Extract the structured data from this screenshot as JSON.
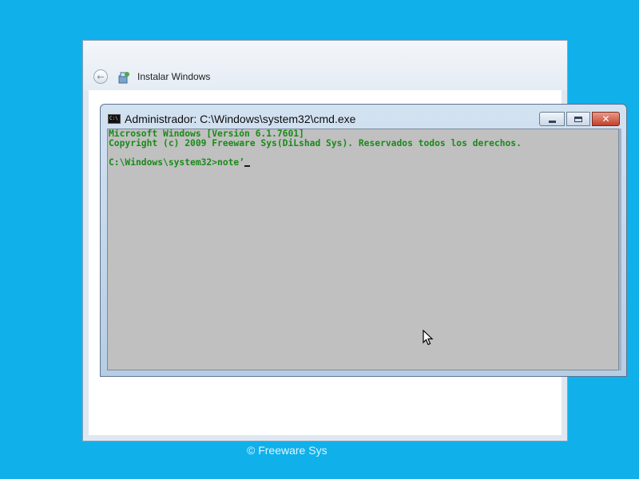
{
  "setup": {
    "title": "Instalar Windows",
    "back_icon": "arrow-left",
    "app_icon": "setup-icon"
  },
  "cmd": {
    "title": "Administrador: C:\\Windows\\system32\\cmd.exe",
    "icon": "cmd-icon",
    "icon_text": "C:\\",
    "buttons": {
      "minimize": "minimize-icon",
      "maximize": "maximize-icon",
      "close": "close-icon"
    },
    "lines": [
      "Microsoft Windows [Versión 6.1.7601]",
      "Copyright (c) 2009 Freeware Sys(DiLshad Sys). Reservados todos los derechos.",
      "",
      "C:\\Windows\\system32>note’"
    ]
  },
  "footer": {
    "copyright": "© Freeware Sys"
  },
  "colors": {
    "desktop": "#10b0ea",
    "console_bg": "#c0c0c0",
    "console_text": "#1a8a1a",
    "close_button": "#c3412a"
  }
}
